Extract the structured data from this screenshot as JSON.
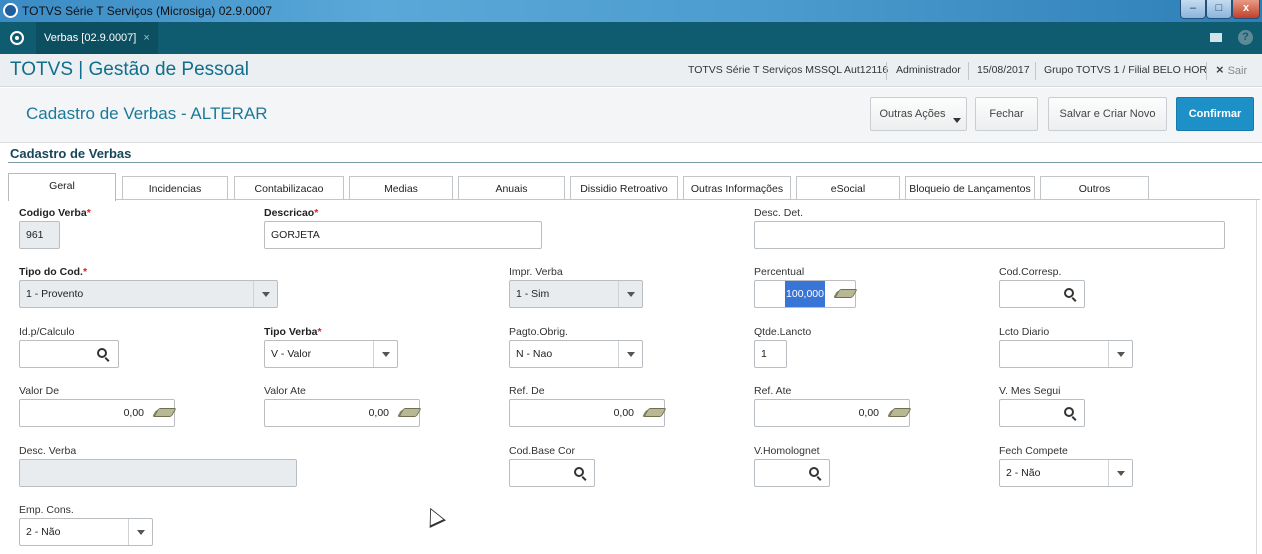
{
  "window": {
    "title": "TOTVS Série T Serviços (Microsiga) 02.9.0007",
    "min": "–",
    "max": "□",
    "close": "x"
  },
  "tabbar": {
    "doc_tab": "Verbas [02.9.0007]",
    "doc_tab_close": "×"
  },
  "header": {
    "brand": "TOTVS | Gestão de Pessoal",
    "environment": "TOTVS Série T Serviços MSSQL Aut12116",
    "user": "Administrador",
    "date": "15/08/2017",
    "branch": "Grupo TOTVS 1 / Filial BELO HOR",
    "exit_icon": "×",
    "exit_label": "Sair"
  },
  "actions": {
    "page_title": "Cadastro de Verbas - ALTERAR",
    "other_actions": "Outras Ações",
    "close": "Fechar",
    "save_new": "Salvar e Criar Novo",
    "confirm": "Confirmar"
  },
  "section": {
    "title": "Cadastro de Verbas"
  },
  "tabs": [
    "Geral",
    "Incidencias",
    "Contabilizacao",
    "Medias",
    "Anuais",
    "Dissidio Retroativo",
    "Outras Informações",
    "eSocial",
    "Bloqueio de Lançamentos",
    "Outros"
  ],
  "fields": {
    "codigo_verba": {
      "label": "Codigo Verba",
      "value": "961"
    },
    "descricao": {
      "label": "Descricao",
      "value": "GORJETA"
    },
    "desc_det": {
      "label": "Desc. Det.",
      "value": ""
    },
    "tipo_cod": {
      "label": "Tipo do Cod.",
      "value": "1 - Provento"
    },
    "impr_verba": {
      "label": "Impr. Verba",
      "value": "1 - Sim"
    },
    "percentual": {
      "label": "Percentual",
      "value": "100,000"
    },
    "cod_corresp": {
      "label": "Cod.Corresp.",
      "value": ""
    },
    "id_calculo": {
      "label": "Id.p/Calculo",
      "value": ""
    },
    "tipo_verba": {
      "label": "Tipo Verba",
      "value": "V - Valor"
    },
    "pagto_obrig": {
      "label": "Pagto.Obrig.",
      "value": "N - Nao"
    },
    "qtde_lancto": {
      "label": "Qtde.Lancto",
      "value": "1"
    },
    "lcto_diario": {
      "label": "Lcto Diario",
      "value": ""
    },
    "valor_de": {
      "label": "Valor De",
      "value": "0,00"
    },
    "valor_ate": {
      "label": "Valor Ate",
      "value": "0,00"
    },
    "ref_de": {
      "label": "Ref. De",
      "value": "0,00"
    },
    "ref_ate": {
      "label": "Ref. Ate",
      "value": "0,00"
    },
    "v_mes_segui": {
      "label": "V. Mes Segui",
      "value": ""
    },
    "desc_verba": {
      "label": "Desc. Verba",
      "value": ""
    },
    "cod_base_cor": {
      "label": "Cod.Base Cor",
      "value": ""
    },
    "v_homolognet": {
      "label": "V.Homolognet",
      "value": ""
    },
    "fech_compete": {
      "label": "Fech Compete",
      "value": "2 - Não"
    },
    "emp_cons": {
      "label": "Emp. Cons.",
      "value": "2 - Não"
    }
  },
  "required_marker": "*"
}
